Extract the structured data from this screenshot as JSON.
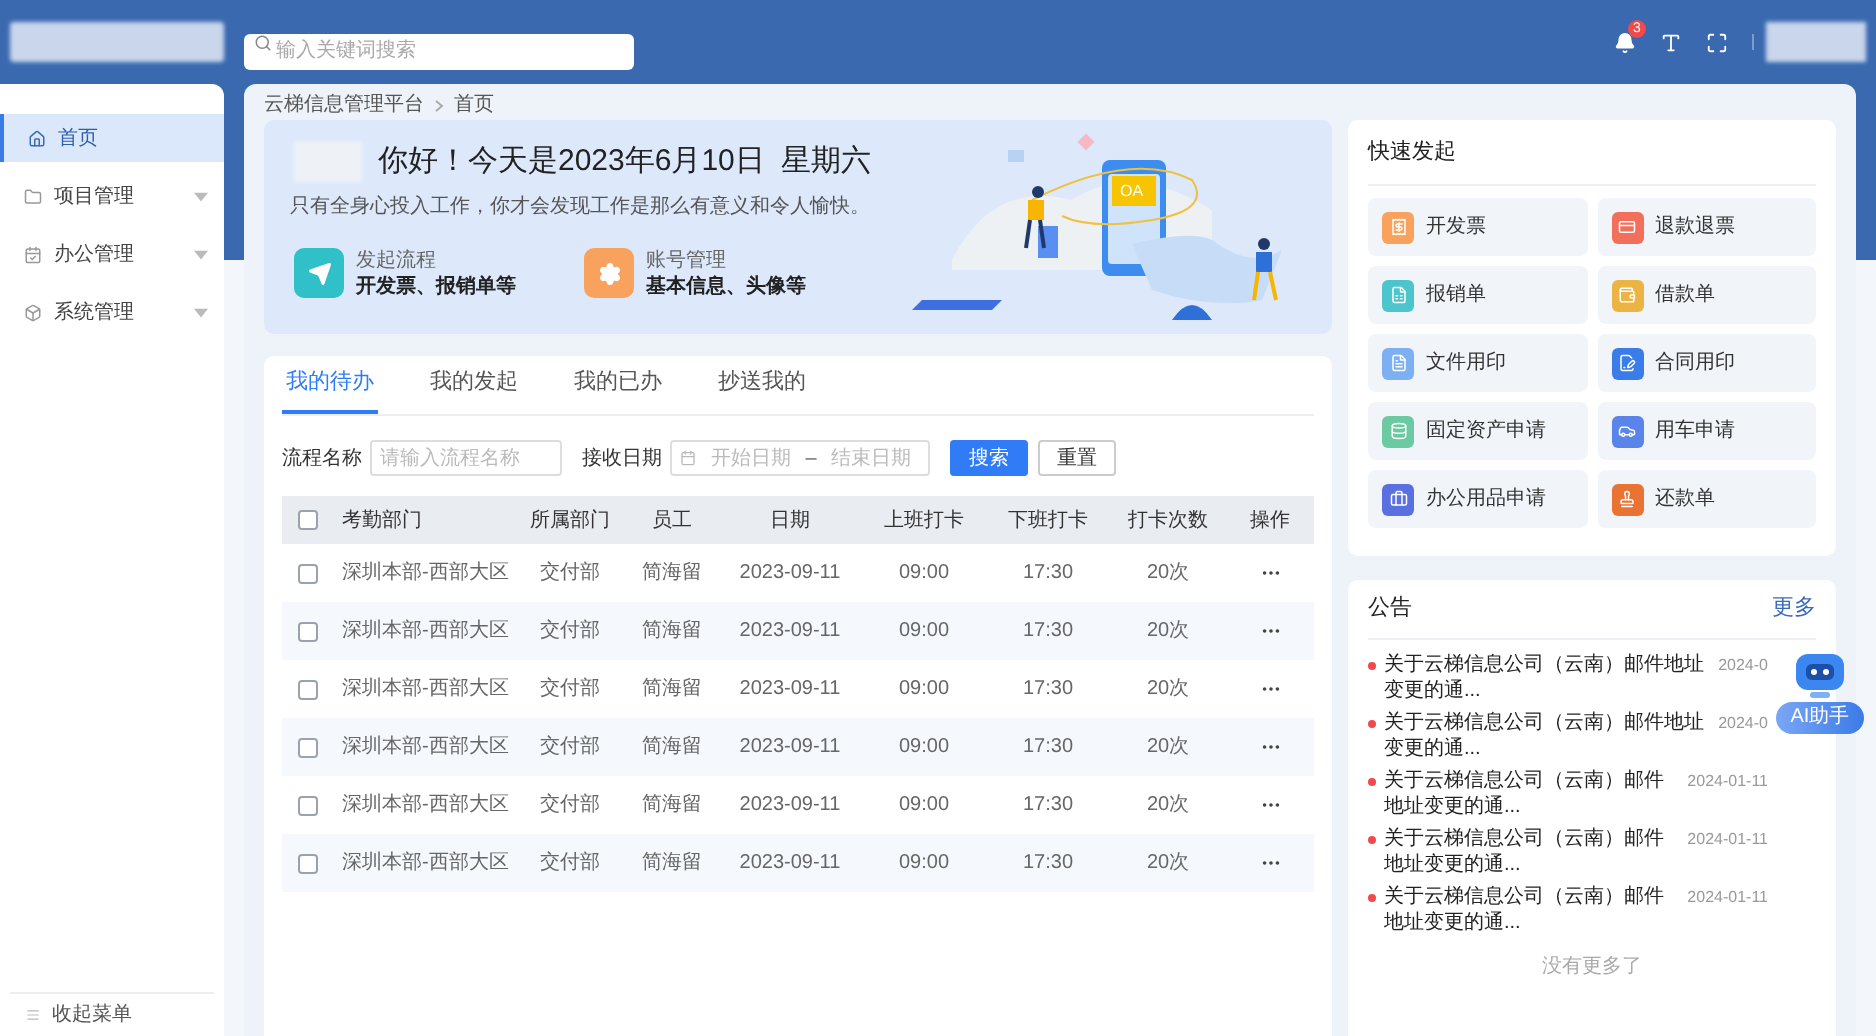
{
  "header": {
    "search": {
      "placeholder": "输入关键词搜索"
    },
    "notifications": {
      "badge": "3"
    }
  },
  "sidebar": {
    "items": [
      {
        "label": "首页",
        "selected": true
      },
      {
        "label": "项目管理",
        "selected": false,
        "expanded": false
      },
      {
        "label": "办公管理",
        "selected": false,
        "expanded": false
      },
      {
        "label": "系统管理",
        "selected": false,
        "expanded": false
      }
    ],
    "collapse_label": "收起菜单"
  },
  "breadcrumb": [
    "云梯信息管理平台",
    "首页"
  ],
  "banner": {
    "greeting": "你好！今天是2023年6月10日  星期六",
    "motto": "只有全身心投入工作，你才会发现工作是那么有意义和令人愉快。",
    "illustration_label": "OA",
    "shortcuts": [
      {
        "title": "发起流程",
        "subtitle": "开发票、报销单等",
        "color": "#2fc0c8"
      },
      {
        "title": "账号管理",
        "subtitle": "基本信息、头像等",
        "color": "#f8a25e"
      }
    ]
  },
  "tabs": [
    {
      "label": "我的待办",
      "selected": true
    },
    {
      "label": "我的发起",
      "selected": false
    },
    {
      "label": "我的已办",
      "selected": false
    },
    {
      "label": "抄送我的",
      "selected": false
    }
  ],
  "filters": {
    "name_label": "流程名称",
    "name_placeholder": "请输入流程名称",
    "date_label": "接收日期",
    "start_placeholder": "开始日期",
    "separator": "–",
    "end_placeholder": "结束日期",
    "search_button": "搜索",
    "reset_button": "重置"
  },
  "table": {
    "header_checked": false,
    "columns": [
      "考勤部门",
      "所属部门",
      "员工",
      "日期",
      "上班打卡",
      "下班打卡",
      "打卡次数",
      "操作"
    ],
    "rows": [
      {
        "checked": false,
        "cells": [
          "深圳本部-西部大区",
          "交付部",
          "简海留",
          "2023-09-11",
          "09:00",
          "17:30",
          "20次"
        ]
      },
      {
        "checked": false,
        "cells": [
          "深圳本部-西部大区",
          "交付部",
          "简海留",
          "2023-09-11",
          "09:00",
          "17:30",
          "20次"
        ]
      },
      {
        "checked": false,
        "cells": [
          "深圳本部-西部大区",
          "交付部",
          "简海留",
          "2023-09-11",
          "09:00",
          "17:30",
          "20次"
        ]
      },
      {
        "checked": false,
        "cells": [
          "深圳本部-西部大区",
          "交付部",
          "简海留",
          "2023-09-11",
          "09:00",
          "17:30",
          "20次"
        ]
      },
      {
        "checked": false,
        "cells": [
          "深圳本部-西部大区",
          "交付部",
          "简海留",
          "2023-09-11",
          "09:00",
          "17:30",
          "20次"
        ]
      },
      {
        "checked": false,
        "cells": [
          "深圳本部-西部大区",
          "交付部",
          "简海留",
          "2023-09-11",
          "09:00",
          "17:30",
          "20次"
        ]
      }
    ]
  },
  "quick_launch": {
    "title": "快速发起",
    "items": [
      {
        "label": "开发票",
        "color": "#f8a25e"
      },
      {
        "label": "退款退票",
        "color": "#f26f5c"
      },
      {
        "label": "报销单",
        "color": "#4cc6cc"
      },
      {
        "label": "借款单",
        "color": "#ebb443"
      },
      {
        "label": "文件用印",
        "color": "#7db0f2"
      },
      {
        "label": "合同用印",
        "color": "#3b7de8"
      },
      {
        "label": "固定资产申请",
        "color": "#6ccaa2"
      },
      {
        "label": "用车申请",
        "color": "#5b84ea"
      },
      {
        "label": "办公用品申请",
        "color": "#5a6fe0"
      },
      {
        "label": "还款单",
        "color": "#ea7232"
      }
    ]
  },
  "notices": {
    "title": "公告",
    "more": "更多",
    "items": [
      {
        "title": "关于云梯信息公司（云南）邮件地址变更的通...",
        "date": "2024-0"
      },
      {
        "title": "关于云梯信息公司（云南）邮件地址变更的通...",
        "date": "2024-0"
      },
      {
        "title": "关于云梯信息公司（云南）邮件地址变更的通...",
        "date": "2024-01-11"
      },
      {
        "title": "关于云梯信息公司（云南）邮件地址变更的通...",
        "date": "2024-01-11"
      },
      {
        "title": "关于云梯信息公司（云南）邮件地址变更的通...",
        "date": "2024-01-11"
      }
    ],
    "end_note": "没有更多了"
  },
  "assistant": {
    "label": "AI助手"
  }
}
